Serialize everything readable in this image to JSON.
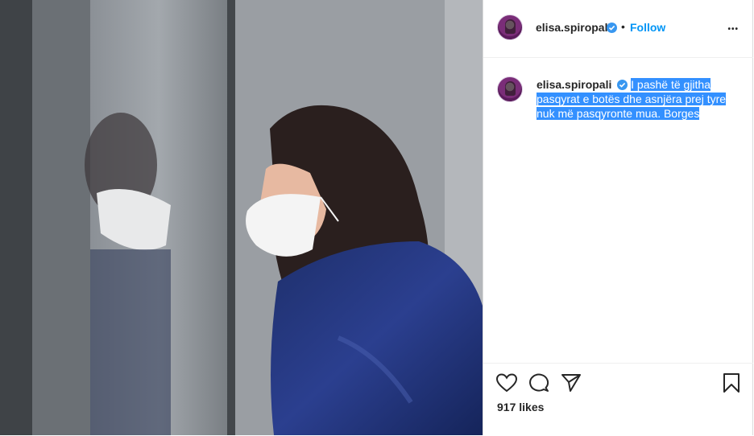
{
  "post": {
    "author": {
      "username": "elisa.spiropali",
      "verified": true
    },
    "header": {
      "separator": "•",
      "follow_label": "Follow",
      "more_label": "•••"
    },
    "caption": {
      "username": "elisa.spiropali",
      "line1": "I pashë të gjitha",
      "line2": "pasqyrat e botës dhe asnjëra prej tyre",
      "line3": "nuk më pasqyronte mua. Borges"
    },
    "likes_text": "917 likes",
    "colors": {
      "link": "#0095f6",
      "verified": "#3897f0",
      "selection": "#3390ff",
      "text": "#262626"
    },
    "icons": [
      "heart-icon",
      "comment-icon",
      "share-icon",
      "bookmark-icon",
      "more-options-icon",
      "verified-badge-icon"
    ]
  }
}
